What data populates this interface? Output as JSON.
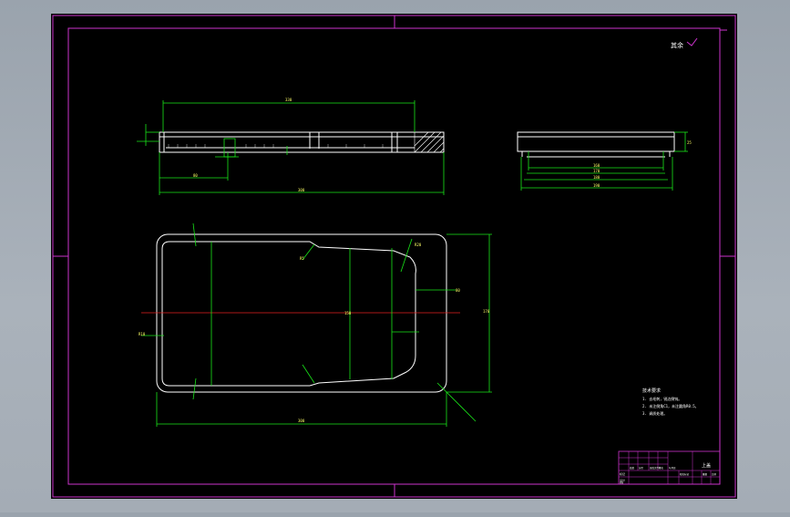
{
  "colors": {
    "sheet": "#000000",
    "frame": "#cc33cc",
    "outline": "#ffffff",
    "dimension": "#19e619",
    "centerline": "#e62020",
    "dim_text": "#ffff66",
    "workspace": "#9aa3ad"
  },
  "roughness_symbol": {
    "label": "其余"
  },
  "notes": {
    "title": "技术要求",
    "lines": [
      "1. 去毛刺，锐边倒钝。",
      "2. 未注倒角C1，未注圆角R0.5。",
      "3. 调质处理。"
    ]
  },
  "title_block": {
    "part_name": "上盖",
    "row_labels": [
      "标记",
      "设计",
      "审核"
    ],
    "cell_values": [
      "处数",
      "分区",
      "更改文件号",
      "签名",
      "年月日"
    ],
    "scale_labels": [
      "阶段标记",
      "重量",
      "比例"
    ]
  },
  "dimensions": {
    "top_width": "330",
    "top_overall": "300",
    "top_small": "80",
    "right_dims": [
      "160",
      "170",
      "180",
      "190"
    ],
    "right_height": "25",
    "plan_width": "300",
    "plan_height": "170",
    "plan_left": "R10",
    "plan_mid": "150",
    "plan_inner": "80",
    "plan_r1": "R5",
    "plan_r2": "R20"
  }
}
